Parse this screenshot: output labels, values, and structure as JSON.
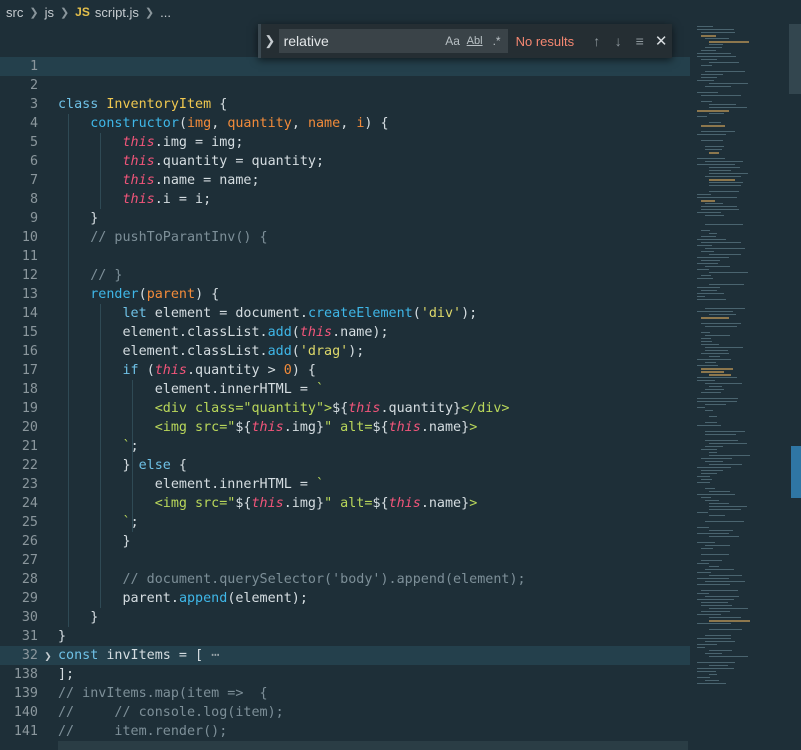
{
  "breadcrumb": {
    "items": [
      "src",
      "js",
      "script.js",
      "..."
    ],
    "file_badge": "JS"
  },
  "find_widget": {
    "query": "relative",
    "match_case_label": "Aa",
    "whole_word_label": "Abl",
    "regex_label": ".*",
    "result_text": "No results",
    "prev_icon": "arrow-up-icon",
    "next_icon": "arrow-down-icon",
    "selection_icon": "find-in-selection-icon",
    "close_icon": "close-icon"
  },
  "editor": {
    "lines": [
      {
        "n": "1",
        "tokens": []
      },
      {
        "n": "2",
        "tokens": []
      },
      {
        "n": "3",
        "tokens": [
          [
            "kw",
            "class "
          ],
          [
            "cls",
            "InventoryItem"
          ],
          [
            "txt",
            " {"
          ]
        ]
      },
      {
        "n": "4",
        "tokens": [
          [
            "txt",
            "    "
          ],
          [
            "fn",
            "constructor"
          ],
          [
            "txt",
            "("
          ],
          [
            "param",
            "img"
          ],
          [
            "txt",
            ", "
          ],
          [
            "param",
            "quantity"
          ],
          [
            "txt",
            ", "
          ],
          [
            "param",
            "name"
          ],
          [
            "txt",
            ", "
          ],
          [
            "param",
            "i"
          ],
          [
            "txt",
            ") {"
          ]
        ]
      },
      {
        "n": "5",
        "tokens": [
          [
            "txt",
            "        "
          ],
          [
            "this",
            "this"
          ],
          [
            "txt",
            ".img = img;"
          ]
        ]
      },
      {
        "n": "6",
        "tokens": [
          [
            "txt",
            "        "
          ],
          [
            "this",
            "this"
          ],
          [
            "txt",
            ".quantity = quantity;"
          ]
        ]
      },
      {
        "n": "7",
        "tokens": [
          [
            "txt",
            "        "
          ],
          [
            "this",
            "this"
          ],
          [
            "txt",
            ".name = name;"
          ]
        ]
      },
      {
        "n": "8",
        "tokens": [
          [
            "txt",
            "        "
          ],
          [
            "this",
            "this"
          ],
          [
            "txt",
            ".i = i;"
          ]
        ]
      },
      {
        "n": "9",
        "tokens": [
          [
            "txt",
            "    }"
          ]
        ]
      },
      {
        "n": "10",
        "tokens": [
          [
            "txt",
            "    "
          ],
          [
            "com",
            "// pushToParantInv() {"
          ]
        ]
      },
      {
        "n": "11",
        "tokens": []
      },
      {
        "n": "12",
        "tokens": [
          [
            "txt",
            "    "
          ],
          [
            "com",
            "// }"
          ]
        ]
      },
      {
        "n": "13",
        "tokens": [
          [
            "txt",
            "    "
          ],
          [
            "fn",
            "render"
          ],
          [
            "txt",
            "("
          ],
          [
            "param",
            "parent"
          ],
          [
            "txt",
            ") {"
          ]
        ]
      },
      {
        "n": "14",
        "tokens": [
          [
            "txt",
            "        "
          ],
          [
            "kw",
            "let "
          ],
          [
            "txt",
            "element = document."
          ],
          [
            "fn",
            "createElement"
          ],
          [
            "txt",
            "("
          ],
          [
            "str",
            "'div'"
          ],
          [
            "txt",
            ");"
          ]
        ]
      },
      {
        "n": "15",
        "tokens": [
          [
            "txt",
            "        element.classList."
          ],
          [
            "fn",
            "add"
          ],
          [
            "txt",
            "("
          ],
          [
            "this",
            "this"
          ],
          [
            "txt",
            ".name);"
          ]
        ]
      },
      {
        "n": "16",
        "tokens": [
          [
            "txt",
            "        element.classList."
          ],
          [
            "fn",
            "add"
          ],
          [
            "txt",
            "("
          ],
          [
            "str",
            "'drag'"
          ],
          [
            "txt",
            ");"
          ]
        ]
      },
      {
        "n": "17",
        "tokens": [
          [
            "txt",
            "        "
          ],
          [
            "kw",
            "if "
          ],
          [
            "txt",
            "("
          ],
          [
            "this",
            "this"
          ],
          [
            "txt",
            ".quantity > "
          ],
          [
            "num",
            "0"
          ],
          [
            "txt",
            ") {"
          ]
        ]
      },
      {
        "n": "18",
        "tokens": [
          [
            "txt",
            "            element.innerHTML = "
          ],
          [
            "tpl",
            "`"
          ]
        ]
      },
      {
        "n": "19",
        "tokens": [
          [
            "txt",
            "            "
          ],
          [
            "tpl",
            "<div class=\"quantity\">"
          ],
          [
            "txt",
            "${"
          ],
          [
            "this",
            "this"
          ],
          [
            "txt",
            ".quantity}"
          ],
          [
            "tpl",
            "</div>"
          ]
        ]
      },
      {
        "n": "20",
        "tokens": [
          [
            "txt",
            "            "
          ],
          [
            "tpl",
            "<img src=\""
          ],
          [
            "txt",
            "${"
          ],
          [
            "this",
            "this"
          ],
          [
            "txt",
            ".img}"
          ],
          [
            "tpl",
            "\" alt="
          ],
          [
            "txt",
            "${"
          ],
          [
            "this",
            "this"
          ],
          [
            "txt",
            ".name}"
          ],
          [
            "tpl",
            ">"
          ]
        ]
      },
      {
        "n": "21",
        "tokens": [
          [
            "txt",
            "        "
          ],
          [
            "tpl",
            "`"
          ],
          [
            "txt",
            ";"
          ]
        ]
      },
      {
        "n": "22",
        "tokens": [
          [
            "txt",
            "        } "
          ],
          [
            "kw",
            "else"
          ],
          [
            "txt",
            " {"
          ]
        ]
      },
      {
        "n": "23",
        "tokens": [
          [
            "txt",
            "            element.innerHTML = "
          ],
          [
            "tpl",
            "`"
          ]
        ]
      },
      {
        "n": "24",
        "tokens": [
          [
            "txt",
            "            "
          ],
          [
            "tpl",
            "<img src=\""
          ],
          [
            "txt",
            "${"
          ],
          [
            "this",
            "this"
          ],
          [
            "txt",
            ".img}"
          ],
          [
            "tpl",
            "\" alt="
          ],
          [
            "txt",
            "${"
          ],
          [
            "this",
            "this"
          ],
          [
            "txt",
            ".name}"
          ],
          [
            "tpl",
            ">"
          ]
        ]
      },
      {
        "n": "25",
        "tokens": [
          [
            "txt",
            "        "
          ],
          [
            "tpl",
            "`"
          ],
          [
            "txt",
            ";"
          ]
        ]
      },
      {
        "n": "26",
        "tokens": [
          [
            "txt",
            "        }"
          ]
        ]
      },
      {
        "n": "27",
        "tokens": []
      },
      {
        "n": "28",
        "tokens": [
          [
            "txt",
            "        "
          ],
          [
            "com",
            "// document.querySelector('body').append(element);"
          ]
        ]
      },
      {
        "n": "29",
        "tokens": [
          [
            "txt",
            "        parent."
          ],
          [
            "fn",
            "append"
          ],
          [
            "txt",
            "(element);"
          ]
        ]
      },
      {
        "n": "30",
        "tokens": [
          [
            "txt",
            "    }"
          ]
        ]
      },
      {
        "n": "31",
        "tokens": [
          [
            "txt",
            "}"
          ]
        ]
      },
      {
        "n": "32",
        "tokens": [
          [
            "kw",
            "const "
          ],
          [
            "txt",
            "invItems = [ "
          ],
          [
            "fold",
            "⋯"
          ]
        ]
      },
      {
        "n": "138",
        "tokens": [
          [
            "txt",
            "];"
          ]
        ]
      },
      {
        "n": "139",
        "tokens": [
          [
            "com",
            "// invItems.map(item =>  {"
          ]
        ]
      },
      {
        "n": "140",
        "tokens": [
          [
            "com",
            "//     // console.log(item);"
          ]
        ]
      },
      {
        "n": "141",
        "tokens": [
          [
            "com",
            "//     item.render();"
          ]
        ]
      }
    ]
  },
  "colors": {
    "background": "#1e2f38",
    "find_no_results": "#f48771",
    "scroll_thumb": "#2f76a4"
  }
}
